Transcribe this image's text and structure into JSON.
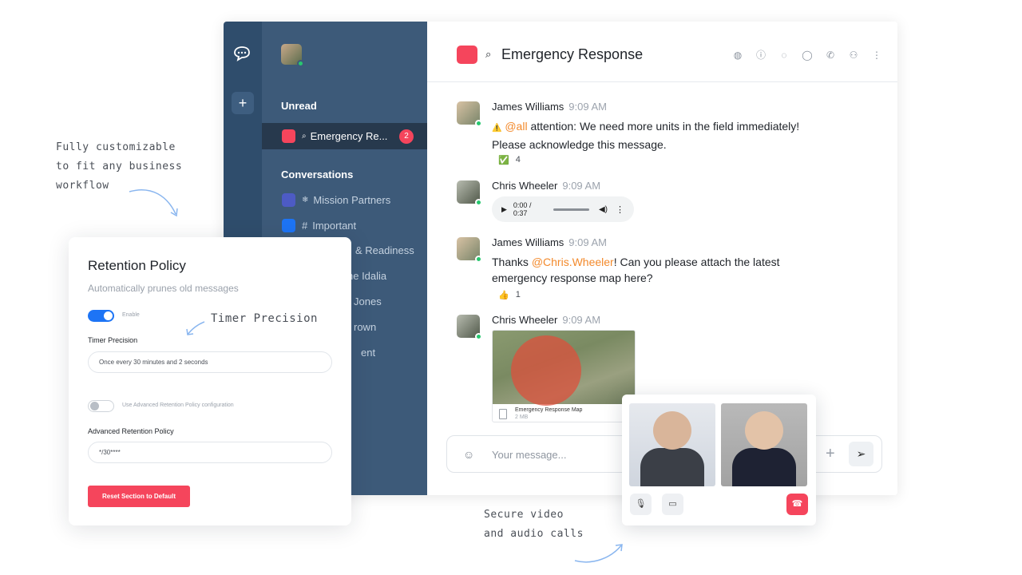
{
  "callouts": {
    "customize": "Fully customizable\nto fit any business\nworkflow",
    "timer": "Timer Precision",
    "calls": "Secure video\nand audio calls"
  },
  "rail": {
    "logo_icon": "chat-bubble-icon",
    "add_label": "+"
  },
  "sidebar": {
    "unread_heading": "Unread",
    "unread_items": [
      {
        "label": "Emergency Re...",
        "color": "#f5455c",
        "badge": "2"
      }
    ],
    "conversations_heading": "Conversations",
    "conversation_items": [
      {
        "label": "Mission Partners",
        "color": "#4d5bc4"
      },
      {
        "label": "Important",
        "prefix": "#",
        "color": "#1d74f5"
      },
      {
        "label": "& Readiness"
      },
      {
        "label": "he Idalia"
      },
      {
        "label": "Jones"
      },
      {
        "label": "rown"
      },
      {
        "label": "ent"
      }
    ]
  },
  "chat": {
    "room_title": "Emergency Response",
    "room_color": "#f5455c",
    "header_icons": [
      "globe-icon",
      "info-icon",
      "threads-icon",
      "discussion-icon",
      "phone-icon",
      "members-icon",
      "kebab-icon"
    ],
    "messages": [
      {
        "author": "James Williams",
        "time": "9:09 AM",
        "prefix_icon": "⚠️",
        "mention": "@all",
        "text": " attention: We need more units in the field immediately! Please acknowledge this message.",
        "reaction_emoji": "✅",
        "reaction_count": "4"
      },
      {
        "author": "Chris Wheeler",
        "time": "9:09 AM",
        "audio_time": "0:00 / 0:37"
      },
      {
        "author": "James Williams",
        "time": "9:09 AM",
        "text_before": "Thanks ",
        "mention": "@Chris.Wheeler",
        "text_after": "! Can you please attach the latest emergency response map here?",
        "reaction_emoji": "👍",
        "reaction_count": "1"
      },
      {
        "author": "Chris Wheeler",
        "time": "9:09 AM",
        "attachment_title": "Emergency Response Map",
        "attachment_size": "2 MB"
      }
    ],
    "composer": {
      "placeholder": "Your message...",
      "emoji_icon": "smiley-icon",
      "add_icon": "plus-icon",
      "send_icon": "send-icon"
    }
  },
  "retention": {
    "title": "Retention Policy",
    "subtitle": "Automatically prunes old messages",
    "enable_label": "Enable",
    "enable_on": true,
    "timer_label": "Timer Precision",
    "timer_value": "Once every 30 minutes and 2 seconds",
    "advanced_toggle_label": "Use Advanced Retention Policy configuration",
    "advanced_on": false,
    "advanced_label": "Advanced Retention Policy",
    "advanced_value": "*/30****",
    "reset_label": "Reset Section to Default"
  },
  "call": {
    "controls": [
      "mic-off-icon",
      "camera-icon",
      "hangup-icon"
    ],
    "end_color": "#f5455c"
  }
}
